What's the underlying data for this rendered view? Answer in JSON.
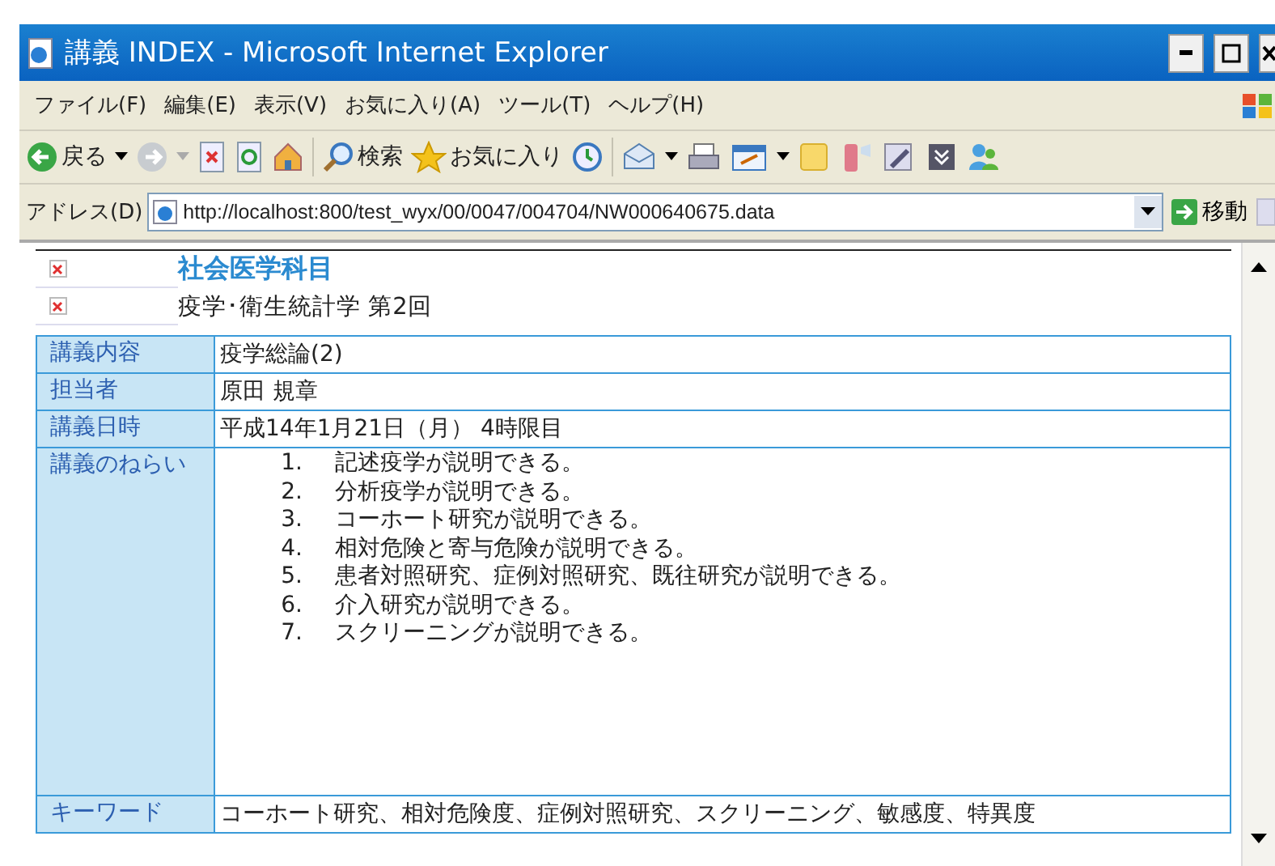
{
  "window": {
    "title": "講義 INDEX - Microsoft Internet Explorer"
  },
  "menu": [
    "ファイル(F)",
    "編集(E)",
    "表示(V)",
    "お気に入り(A)",
    "ツール(T)",
    "ヘルプ(H)"
  ],
  "toolbar": {
    "back": "戻る",
    "search": "検索",
    "favorites": "お気に入り"
  },
  "address": {
    "label": "アドレス(D)",
    "value": "http://localhost:800/test_wyx/00/0047/004704/NW000640675.data",
    "go": "移動"
  },
  "header": {
    "category": "社会医学科目",
    "course": "疫学･衛生統計学  第2回"
  },
  "table": {
    "rows": [
      {
        "label": "講義内容",
        "kind": "text",
        "value": "疫学総論(2)"
      },
      {
        "label": "担当者",
        "kind": "text",
        "value": "原田  規章"
      },
      {
        "label": "講義日時",
        "kind": "text",
        "value": "平成14年1月21日（月） 4時限目"
      },
      {
        "label": "講義のねらい",
        "kind": "list",
        "items": [
          {
            "number": "1.",
            "text": "記述疫学が説明できる。"
          },
          {
            "number": "2.",
            "text": "分析疫学が説明できる。"
          },
          {
            "number": "3.",
            "text": "コーホート研究が説明できる。"
          },
          {
            "number": "4.",
            "text": "相対危険と寄与危険が説明できる。"
          },
          {
            "number": "5.",
            "text": "患者対照研究、症例対照研究、既往研究が説明できる。"
          },
          {
            "number": "6.",
            "text": "介入研究が説明できる。"
          },
          {
            "number": "7.",
            "text": "スクリーニングが説明できる。"
          }
        ]
      },
      {
        "label": "キーワード",
        "kind": "text",
        "value": "コーホート研究、相対危険度、症例対照研究、スクリーニング、敏感度、特異度"
      }
    ]
  }
}
